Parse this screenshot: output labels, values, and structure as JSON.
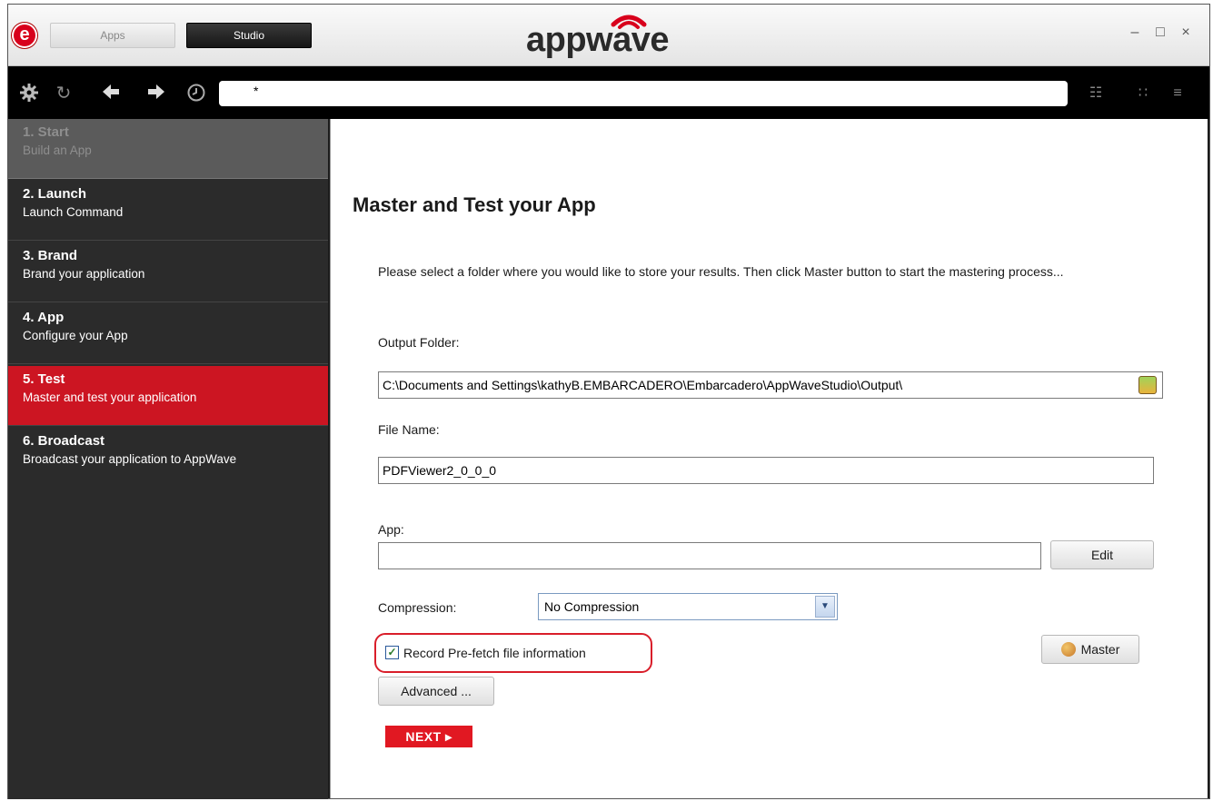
{
  "titlebar": {
    "logo_letter": "e",
    "tabs": [
      "Apps",
      "Studio"
    ],
    "brand": "appwave",
    "controls": {
      "minimize": "–",
      "maximize": "□",
      "close": "×"
    }
  },
  "toolbar": {
    "address_value": "*",
    "icons": [
      "gear-icon",
      "refresh-icon",
      "back-arrow-icon",
      "forward-arrow-icon",
      "history-clock-icon"
    ],
    "view_icons": [
      "list-view-icon",
      "grid-view-icon",
      "menu-icon"
    ]
  },
  "sidebar": {
    "steps": [
      {
        "title": "1. Start",
        "subtitle": "Build an App",
        "state": "disabled"
      },
      {
        "title": "2. Launch",
        "subtitle": "Launch Command",
        "state": "normal"
      },
      {
        "title": "3. Brand",
        "subtitle": "Brand your application",
        "state": "normal"
      },
      {
        "title": "4. App",
        "subtitle": "Configure your App",
        "state": "normal"
      },
      {
        "title": "5. Test",
        "subtitle": "Master and test your application",
        "state": "active"
      },
      {
        "title": "6. Broadcast",
        "subtitle": "Broadcast your application to AppWave",
        "state": "normal"
      }
    ]
  },
  "main": {
    "heading": "Master and Test your App",
    "description": "Please select a folder where you would like to store your results. Then click Master button to start the mastering process...",
    "output_folder_label": "Output Folder:",
    "output_folder_value": "C:\\Documents and Settings\\kathyB.EMBARCADERO\\Embarcadero\\AppWaveStudio\\Output\\",
    "file_name_label": "File Name:",
    "file_name_value": "PDFViewer2_0_0_0",
    "app_label": "App:",
    "app_value": "",
    "edit_button": "Edit",
    "compression_label": "Compression:",
    "compression_value": "No Compression",
    "prefetch_label": "Record Pre-fetch file information",
    "prefetch_checked": true,
    "master_button": "Master",
    "advanced_button": "Advanced ...",
    "next_button": "NEXT ▸"
  },
  "colors": {
    "accent_red": "#cc1522",
    "next_red": "#e11822",
    "sidebar_bg": "#2b2b2b",
    "toolbar_bg": "#000000"
  }
}
